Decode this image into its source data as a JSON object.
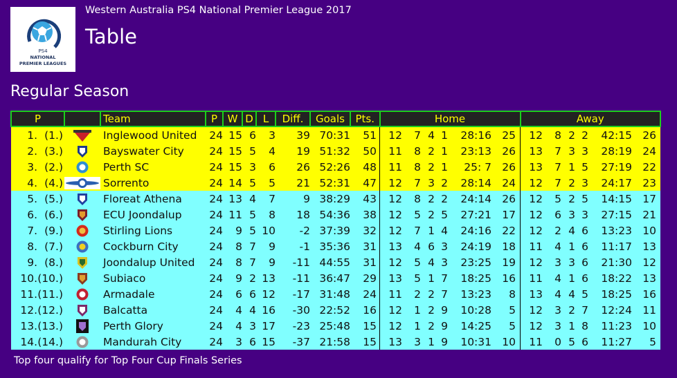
{
  "header": {
    "league": "Western Australia PS4 National Premier League 2017",
    "title": "Table",
    "logo_alt": "PS4 National Premier Leagues",
    "logo_lines": [
      "PS4",
      "NATIONAL",
      "PREMIER LEAGUES"
    ]
  },
  "section": "Regular Season",
  "table": {
    "headers": {
      "pos": "P",
      "logo": "",
      "team": "Team",
      "played": "P",
      "won": "W",
      "drawn": "D",
      "lost": "L",
      "diff": "Diff.",
      "goals": "Goals",
      "pts": "Pts.",
      "home": "Home",
      "away": "Away"
    },
    "colors": {
      "qualify_row": "#ffff00",
      "other_row": "#80ffff",
      "header_bg": "#222222",
      "header_text": "#ffff00",
      "header_border": "#1ccf1c",
      "page_bg": "#460082"
    },
    "rows": [
      {
        "pos": "1.",
        "prev": "(1.)",
        "logo": "inglewood-united-crest",
        "team": "Inglewood United",
        "p": "24",
        "w": "15",
        "d": "6",
        "l": "3",
        "diff": "39",
        "goals": "70:31",
        "pts": "51",
        "home": {
          "p": "12",
          "w": "7",
          "d": "4",
          "l": "1",
          "goals": "28:16",
          "pts": "25"
        },
        "away": {
          "p": "12",
          "w": "8",
          "d": "2",
          "l": "2",
          "goals": "42:15",
          "pts": "26"
        },
        "zone": "top"
      },
      {
        "pos": "2.",
        "prev": "(3.)",
        "logo": "bayswater-city-crest",
        "team": "Bayswater City",
        "p": "24",
        "w": "15",
        "d": "5",
        "l": "4",
        "diff": "19",
        "goals": "51:32",
        "pts": "50",
        "home": {
          "p": "11",
          "w": "8",
          "d": "2",
          "l": "1",
          "goals": "23:13",
          "pts": "26"
        },
        "away": {
          "p": "13",
          "w": "7",
          "d": "3",
          "l": "3",
          "goals": "28:19",
          "pts": "24"
        },
        "zone": "top"
      },
      {
        "pos": "3.",
        "prev": "(2.)",
        "logo": "perth-sc-crest",
        "team": "Perth SC",
        "p": "24",
        "w": "15",
        "d": "3",
        "l": "6",
        "diff": "26",
        "goals": "52:26",
        "pts": "48",
        "home": {
          "p": "11",
          "w": "8",
          "d": "2",
          "l": "1",
          "goals": "25: 7",
          "pts": "26"
        },
        "away": {
          "p": "13",
          "w": "7",
          "d": "1",
          "l": "5",
          "goals": "27:19",
          "pts": "22"
        },
        "zone": "top"
      },
      {
        "pos": "4.",
        "prev": "(4.)",
        "logo": "sorrento-crest",
        "team": "Sorrento",
        "p": "24",
        "w": "14",
        "d": "5",
        "l": "5",
        "diff": "21",
        "goals": "52:31",
        "pts": "47",
        "home": {
          "p": "12",
          "w": "7",
          "d": "3",
          "l": "2",
          "goals": "28:14",
          "pts": "24"
        },
        "away": {
          "p": "12",
          "w": "7",
          "d": "2",
          "l": "3",
          "goals": "24:17",
          "pts": "23"
        },
        "zone": "top"
      },
      {
        "pos": "5.",
        "prev": "(5.)",
        "logo": "floreat-athena-crest",
        "team": "Floreat Athena",
        "p": "24",
        "w": "13",
        "d": "4",
        "l": "7",
        "diff": "9",
        "goals": "38:29",
        "pts": "43",
        "home": {
          "p": "12",
          "w": "8",
          "d": "2",
          "l": "2",
          "goals": "24:14",
          "pts": "26"
        },
        "away": {
          "p": "12",
          "w": "5",
          "d": "2",
          "l": "5",
          "goals": "14:15",
          "pts": "17"
        },
        "zone": "rest"
      },
      {
        "pos": "6.",
        "prev": "(6.)",
        "logo": "ecu-joondalup-crest",
        "team": "ECU Joondalup",
        "p": "24",
        "w": "11",
        "d": "5",
        "l": "8",
        "diff": "18",
        "goals": "54:36",
        "pts": "38",
        "home": {
          "p": "12",
          "w": "5",
          "d": "2",
          "l": "5",
          "goals": "27:21",
          "pts": "17"
        },
        "away": {
          "p": "12",
          "w": "6",
          "d": "3",
          "l": "3",
          "goals": "27:15",
          "pts": "21"
        },
        "zone": "rest"
      },
      {
        "pos": "7.",
        "prev": "(9.)",
        "logo": "stirling-lions-crest",
        "team": "Stirling Lions",
        "p": "24",
        "w": "9",
        "d": "5",
        "l": "10",
        "diff": "-2",
        "goals": "37:39",
        "pts": "32",
        "home": {
          "p": "12",
          "w": "7",
          "d": "1",
          "l": "4",
          "goals": "24:16",
          "pts": "22"
        },
        "away": {
          "p": "12",
          "w": "2",
          "d": "4",
          "l": "6",
          "goals": "13:23",
          "pts": "10"
        },
        "zone": "rest"
      },
      {
        "pos": "8.",
        "prev": "(7.)",
        "logo": "cockburn-city-crest",
        "team": "Cockburn City",
        "p": "24",
        "w": "8",
        "d": "7",
        "l": "9",
        "diff": "-1",
        "goals": "35:36",
        "pts": "31",
        "home": {
          "p": "13",
          "w": "4",
          "d": "6",
          "l": "3",
          "goals": "24:19",
          "pts": "18"
        },
        "away": {
          "p": "11",
          "w": "4",
          "d": "1",
          "l": "6",
          "goals": "11:17",
          "pts": "13"
        },
        "zone": "rest"
      },
      {
        "pos": "9.",
        "prev": "(8.)",
        "logo": "joondalup-united-crest",
        "team": "Joondalup United",
        "p": "24",
        "w": "8",
        "d": "7",
        "l": "9",
        "diff": "-11",
        "goals": "44:55",
        "pts": "31",
        "home": {
          "p": "12",
          "w": "5",
          "d": "4",
          "l": "3",
          "goals": "23:25",
          "pts": "19"
        },
        "away": {
          "p": "12",
          "w": "3",
          "d": "3",
          "l": "6",
          "goals": "21:30",
          "pts": "12"
        },
        "zone": "rest"
      },
      {
        "pos": "10.",
        "prev": "(10.)",
        "logo": "subiaco-crest",
        "team": "Subiaco",
        "p": "24",
        "w": "9",
        "d": "2",
        "l": "13",
        "diff": "-11",
        "goals": "36:47",
        "pts": "29",
        "home": {
          "p": "13",
          "w": "5",
          "d": "1",
          "l": "7",
          "goals": "18:25",
          "pts": "16"
        },
        "away": {
          "p": "11",
          "w": "4",
          "d": "1",
          "l": "6",
          "goals": "18:22",
          "pts": "13"
        },
        "zone": "rest"
      },
      {
        "pos": "11.",
        "prev": "(11.)",
        "logo": "armadale-crest",
        "team": "Armadale",
        "p": "24",
        "w": "6",
        "d": "6",
        "l": "12",
        "diff": "-17",
        "goals": "31:48",
        "pts": "24",
        "home": {
          "p": "11",
          "w": "2",
          "d": "2",
          "l": "7",
          "goals": "13:23",
          "pts": "8"
        },
        "away": {
          "p": "13",
          "w": "4",
          "d": "4",
          "l": "5",
          "goals": "18:25",
          "pts": "16"
        },
        "zone": "rest"
      },
      {
        "pos": "12.",
        "prev": "(12.)",
        "logo": "balcatta-crest",
        "team": "Balcatta",
        "p": "24",
        "w": "4",
        "d": "4",
        "l": "16",
        "diff": "-30",
        "goals": "22:52",
        "pts": "16",
        "home": {
          "p": "12",
          "w": "1",
          "d": "2",
          "l": "9",
          "goals": "10:28",
          "pts": "5"
        },
        "away": {
          "p": "12",
          "w": "3",
          "d": "2",
          "l": "7",
          "goals": "12:24",
          "pts": "11"
        },
        "zone": "rest"
      },
      {
        "pos": "13.",
        "prev": "(13.)",
        "logo": "perth-glory-crest",
        "team": "Perth Glory",
        "p": "24",
        "w": "4",
        "d": "3",
        "l": "17",
        "diff": "-23",
        "goals": "25:48",
        "pts": "15",
        "home": {
          "p": "12",
          "w": "1",
          "d": "2",
          "l": "9",
          "goals": "14:25",
          "pts": "5"
        },
        "away": {
          "p": "12",
          "w": "3",
          "d": "1",
          "l": "8",
          "goals": "11:23",
          "pts": "10"
        },
        "zone": "rest"
      },
      {
        "pos": "14.",
        "prev": "(14.)",
        "logo": "mandurah-city-crest",
        "team": "Mandurah City",
        "p": "24",
        "w": "3",
        "d": "6",
        "l": "15",
        "diff": "-37",
        "goals": "21:58",
        "pts": "15",
        "home": {
          "p": "13",
          "w": "3",
          "d": "1",
          "l": "9",
          "goals": "10:31",
          "pts": "10"
        },
        "away": {
          "p": "11",
          "w": "0",
          "d": "5",
          "l": "6",
          "goals": "11:27",
          "pts": "5"
        },
        "zone": "rest"
      }
    ]
  },
  "footer": "Top four qualify for Top Four Cup Finals Series"
}
